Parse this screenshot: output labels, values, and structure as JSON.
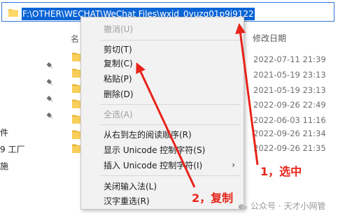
{
  "address_bar": {
    "path": "F:\\OTHER\\WECHAT\\WeChat Files\\wxid_0yuzg01p9j9122"
  },
  "nav_pane": {
    "fragments": [
      "件",
      "9 工厂",
      "施"
    ]
  },
  "file_list": {
    "name_header": "名",
    "date_header": "修改日期",
    "dates": [
      "2022-07-11 21:39",
      "2021-05-19 23:13",
      "2021-05-19 23:13",
      "2022-09-26 22:49",
      "2022-06-03 11:16",
      "2022-09-26 21:34",
      "2022-09-26 21:35"
    ]
  },
  "context_menu": {
    "items": [
      {
        "label": "撤消(U)",
        "disabled": true
      },
      {
        "label": "剪切(T)",
        "disabled": false
      },
      {
        "label": "复制(C)",
        "disabled": false
      },
      {
        "label": "粘贴(P)",
        "disabled": false
      },
      {
        "label": "删除(D)",
        "disabled": false
      },
      {
        "label": "全选(A)",
        "disabled": true
      },
      {
        "label": "从右到左的阅读顺序(R)",
        "disabled": false
      },
      {
        "label": "显示 Unicode 控制字符(S)",
        "disabled": false
      },
      {
        "label": "插入 Unicode 控制字符(I)",
        "disabled": false
      },
      {
        "label": "关闭输入法(L)",
        "disabled": false
      },
      {
        "label": "汉字重选(R)",
        "disabled": false
      }
    ],
    "submenu_arrow": "›"
  },
  "annotations": {
    "step1": "1，选中",
    "step2": "2，复制",
    "accent_color": "#e8231a"
  },
  "watermark": {
    "text": "公众号 · 天才小网管"
  }
}
